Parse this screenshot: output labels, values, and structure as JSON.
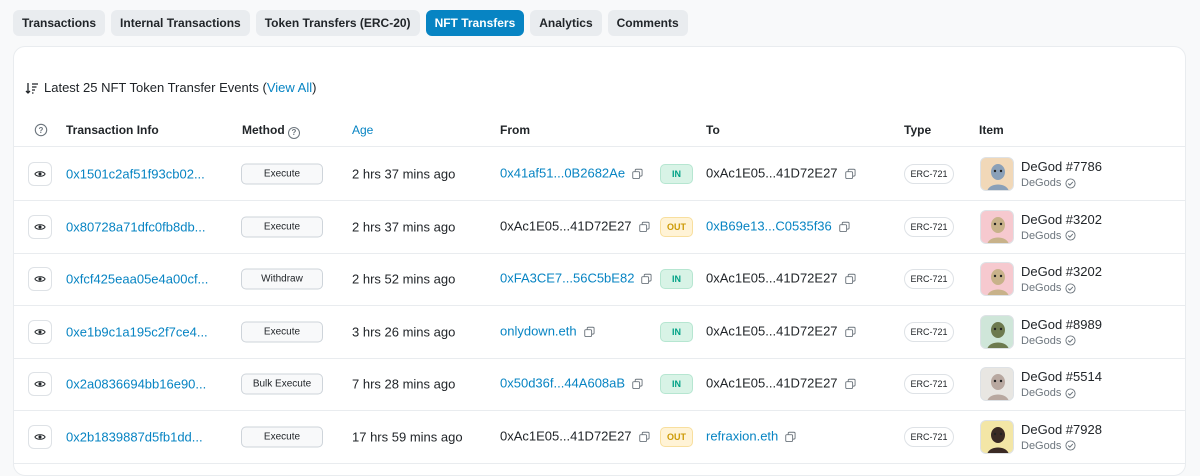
{
  "tabs": [
    {
      "label": "Transactions",
      "active": false
    },
    {
      "label": "Internal Transactions",
      "active": false
    },
    {
      "label": "Token Transfers (ERC-20)",
      "active": false
    },
    {
      "label": "NFT Transfers",
      "active": true
    },
    {
      "label": "Analytics",
      "active": false
    },
    {
      "label": "Comments",
      "active": false
    }
  ],
  "caption": {
    "text": "Latest 25 NFT Token Transfer Events",
    "open_paren": "(",
    "view_all": "View All",
    "close_paren": ")"
  },
  "columns": {
    "txn_info": "Transaction Info",
    "method": "Method",
    "age": "Age",
    "from": "From",
    "to": "To",
    "type": "Type",
    "item": "Item"
  },
  "rows": [
    {
      "hash": "0x1501c2af51f93cb02...",
      "method": "Execute",
      "age": "2 hrs 37 mins ago",
      "from": "0x41af51...0B2682Ae",
      "from_link": true,
      "direction": "IN",
      "to": "0xAc1E05...41D72E27",
      "to_link": false,
      "type": "ERC-721",
      "item_name": "DeGod #7786",
      "collection": "DeGods",
      "thumb_bg": "#f1d8b8",
      "thumb_fg": "#8aa0b8"
    },
    {
      "hash": "0x80728a71dfc0fb8db...",
      "method": "Execute",
      "age": "2 hrs 37 mins ago",
      "from": "0xAc1E05...41D72E27",
      "from_link": false,
      "direction": "OUT",
      "to": "0xB69e13...C0535f36",
      "to_link": true,
      "type": "ERC-721",
      "item_name": "DeGod #3202",
      "collection": "DeGods",
      "thumb_bg": "#f6c9cf",
      "thumb_fg": "#c8b28a"
    },
    {
      "hash": "0xfcf425eaa05e4a00cf...",
      "method": "Withdraw",
      "age": "2 hrs 52 mins ago",
      "from": "0xFA3CE7...56C5bE82",
      "from_link": true,
      "direction": "IN",
      "to": "0xAc1E05...41D72E27",
      "to_link": false,
      "type": "ERC-721",
      "item_name": "DeGod #3202",
      "collection": "DeGods",
      "thumb_bg": "#f6c9cf",
      "thumb_fg": "#c8b28a"
    },
    {
      "hash": "0xe1b9c1a195c2f7ce4...",
      "method": "Execute",
      "age": "3 hrs 26 mins ago",
      "from": "onlydown.eth",
      "from_link": true,
      "direction": "IN",
      "to": "0xAc1E05...41D72E27",
      "to_link": false,
      "type": "ERC-721",
      "item_name": "DeGod #8989",
      "collection": "DeGods",
      "thumb_bg": "#cfe6d9",
      "thumb_fg": "#6d7a4f"
    },
    {
      "hash": "0x2a0836694bb16e90...",
      "method": "Bulk Execute",
      "age": "7 hrs 28 mins ago",
      "from": "0x50d36f...44A608aB",
      "from_link": true,
      "direction": "IN",
      "to": "0xAc1E05...41D72E27",
      "to_link": false,
      "type": "ERC-721",
      "item_name": "DeGod #5514",
      "collection": "DeGods",
      "thumb_bg": "#e8e6e2",
      "thumb_fg": "#b8a8a0"
    },
    {
      "hash": "0x2b1839887d5fb1dd...",
      "method": "Execute",
      "age": "17 hrs 59 mins ago",
      "from": "0xAc1E05...41D72E27",
      "from_link": false,
      "direction": "OUT",
      "to": "refraxion.eth",
      "to_link": true,
      "type": "ERC-721",
      "item_name": "DeGod #7928",
      "collection": "DeGods",
      "thumb_bg": "#f3e6a6",
      "thumb_fg": "#3a2a24"
    }
  ]
}
